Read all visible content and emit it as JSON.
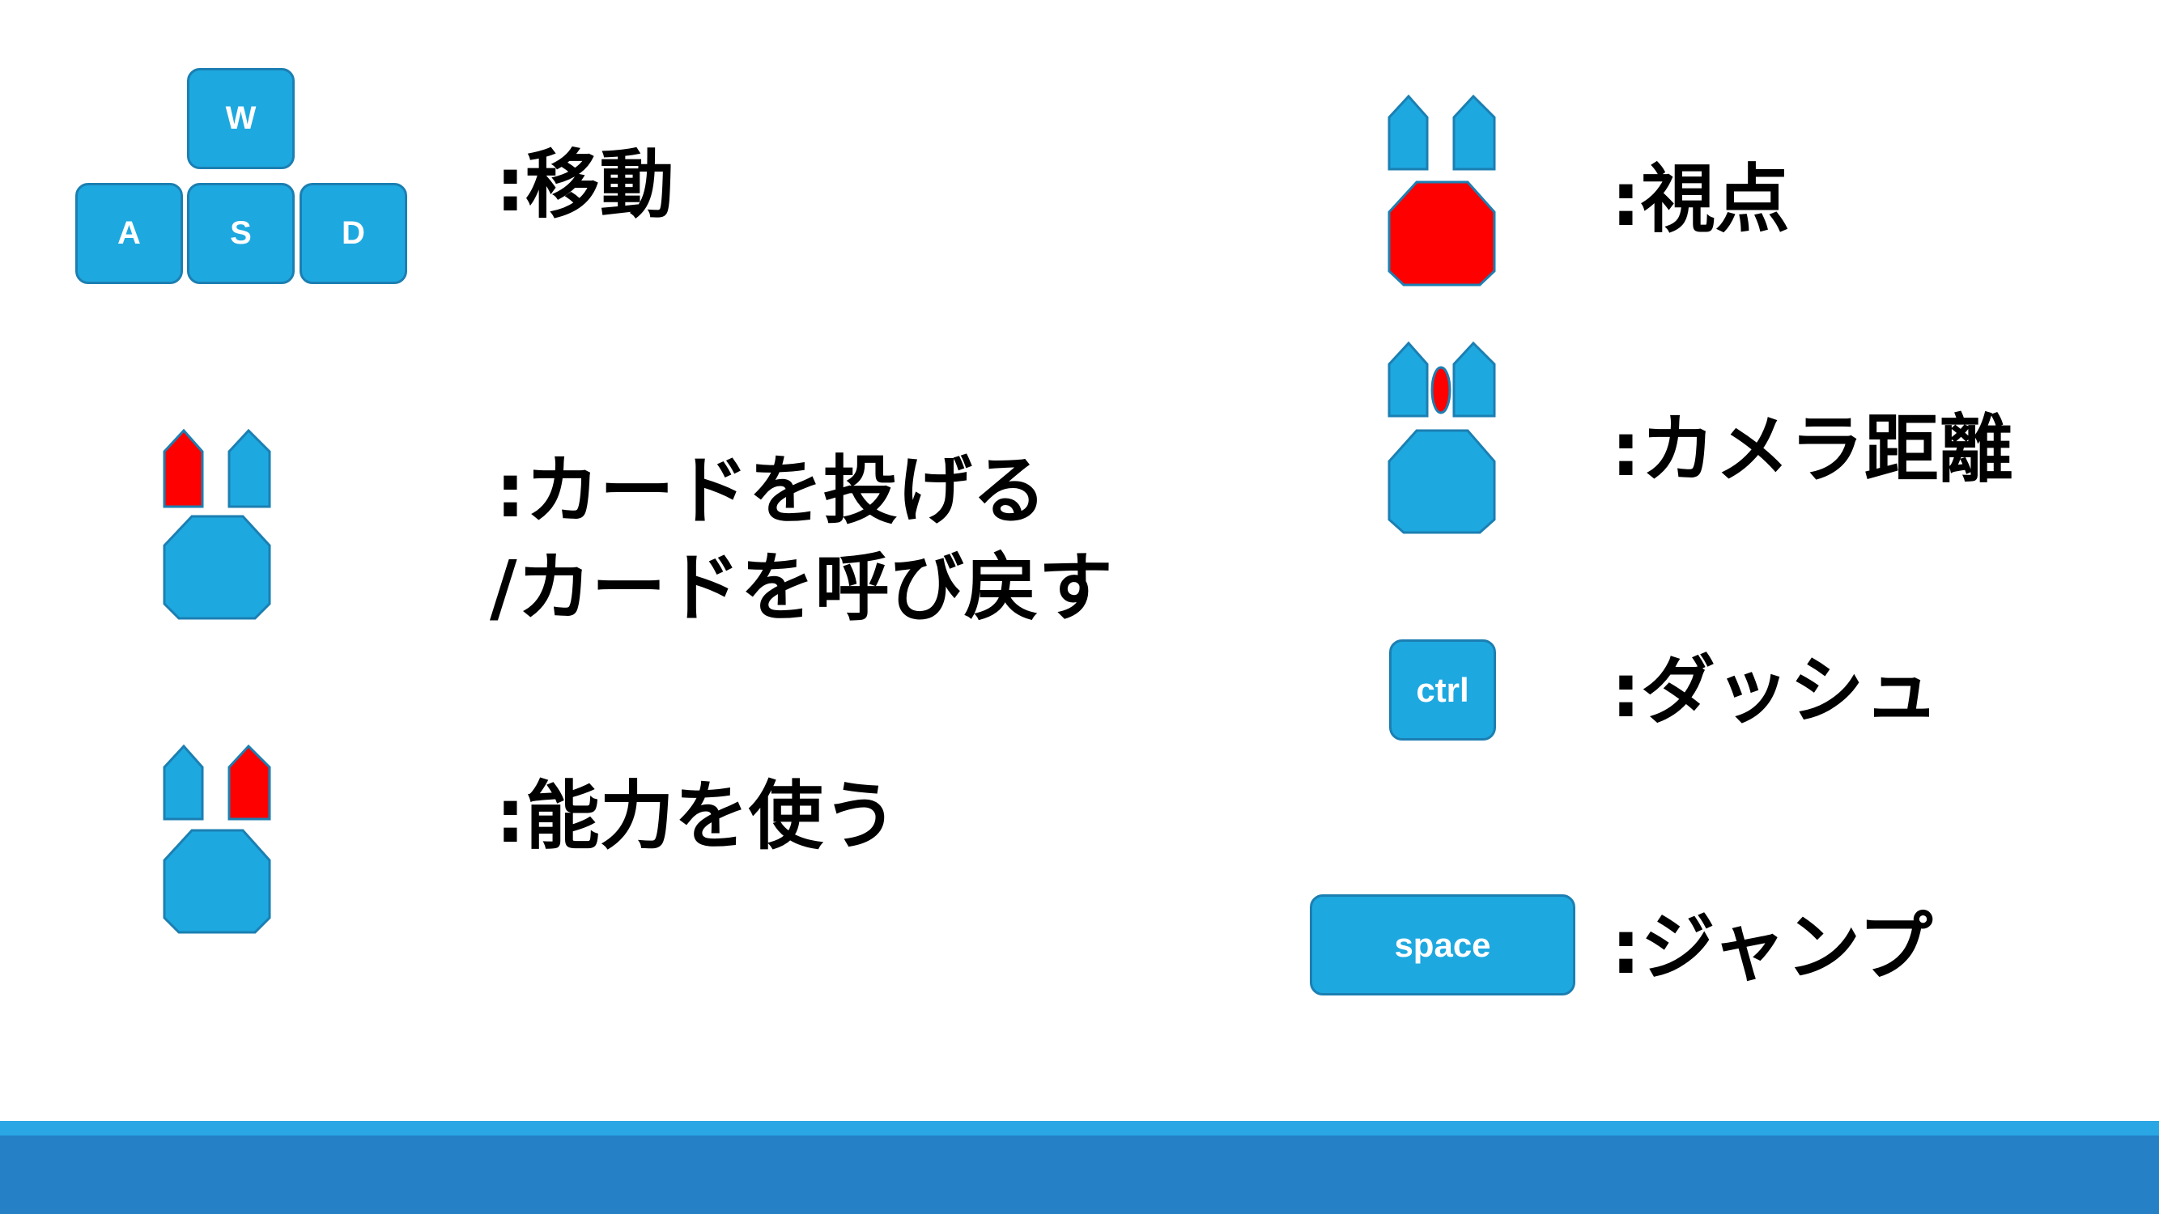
{
  "controls": {
    "move": {
      "label": ":移動",
      "keys": [
        "W",
        "A",
        "S",
        "D"
      ]
    },
    "throw": {
      "line1": ":カードを投げる",
      "line2": "/カードを呼び戻す",
      "icon": "mouse-left-button-icon"
    },
    "ability": {
      "label": ":能力を使う",
      "icon": "mouse-right-button-icon"
    },
    "view": {
      "label": ":視点",
      "icon": "mouse-body-icon"
    },
    "camera": {
      "label": ":カメラ距離",
      "icon": "mouse-wheel-icon"
    },
    "dash": {
      "label": ":ダッシュ",
      "key": "ctrl"
    },
    "jump": {
      "label": ":ジャンプ",
      "key": "space"
    }
  },
  "colors": {
    "key_fill": "#1ea8e0",
    "key_border": "#1b7fb2",
    "highlight": "#ff0000",
    "bottom_bar_light": "#2aa6e4",
    "bottom_bar_dark": "#2580c5"
  }
}
